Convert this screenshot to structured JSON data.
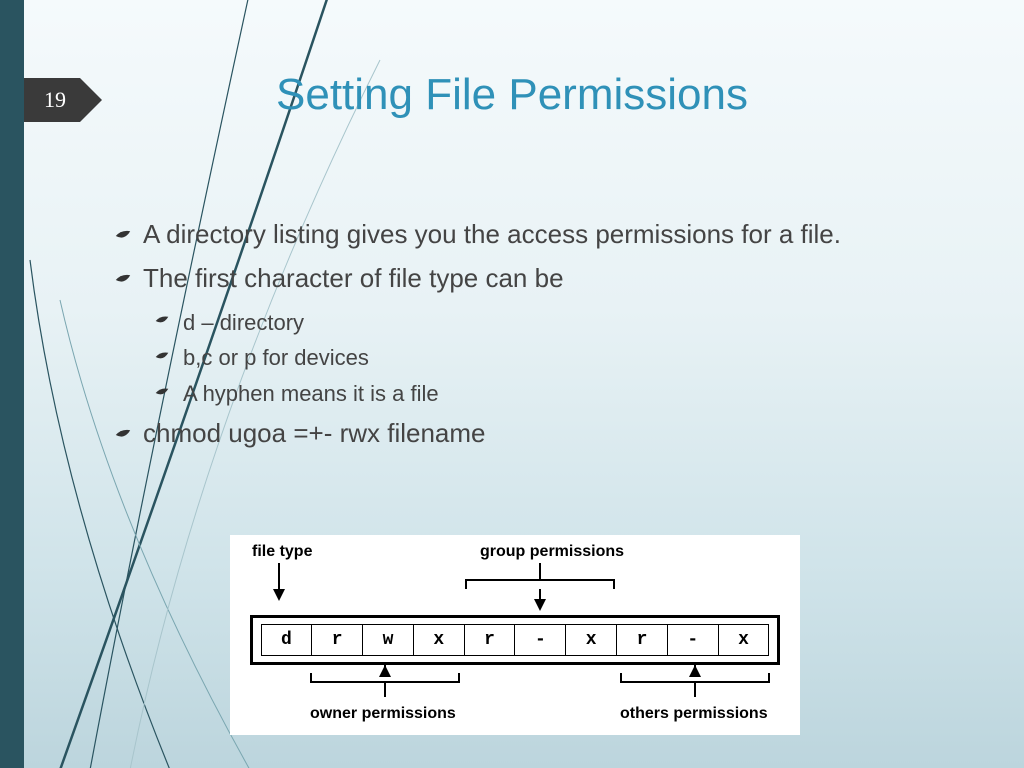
{
  "page_number": "19",
  "title": "Setting File Permissions",
  "bullets": {
    "b1": "A directory listing gives you the access permissions for a file.",
    "b2": "The first character of file type can be",
    "b2a": "d – directory",
    "b2b": "b,c or p for devices",
    "b2c": "A hyphen means it is a file",
    "b3": "chmod ugoa =+- rwx filename"
  },
  "diagram": {
    "label_filetype": "file type",
    "label_group": "group permissions",
    "label_owner": "owner permissions",
    "label_others": "others permissions",
    "cells": [
      "d",
      "r",
      "w",
      "x",
      "r",
      "-",
      "x",
      "r",
      "-",
      "x"
    ]
  }
}
